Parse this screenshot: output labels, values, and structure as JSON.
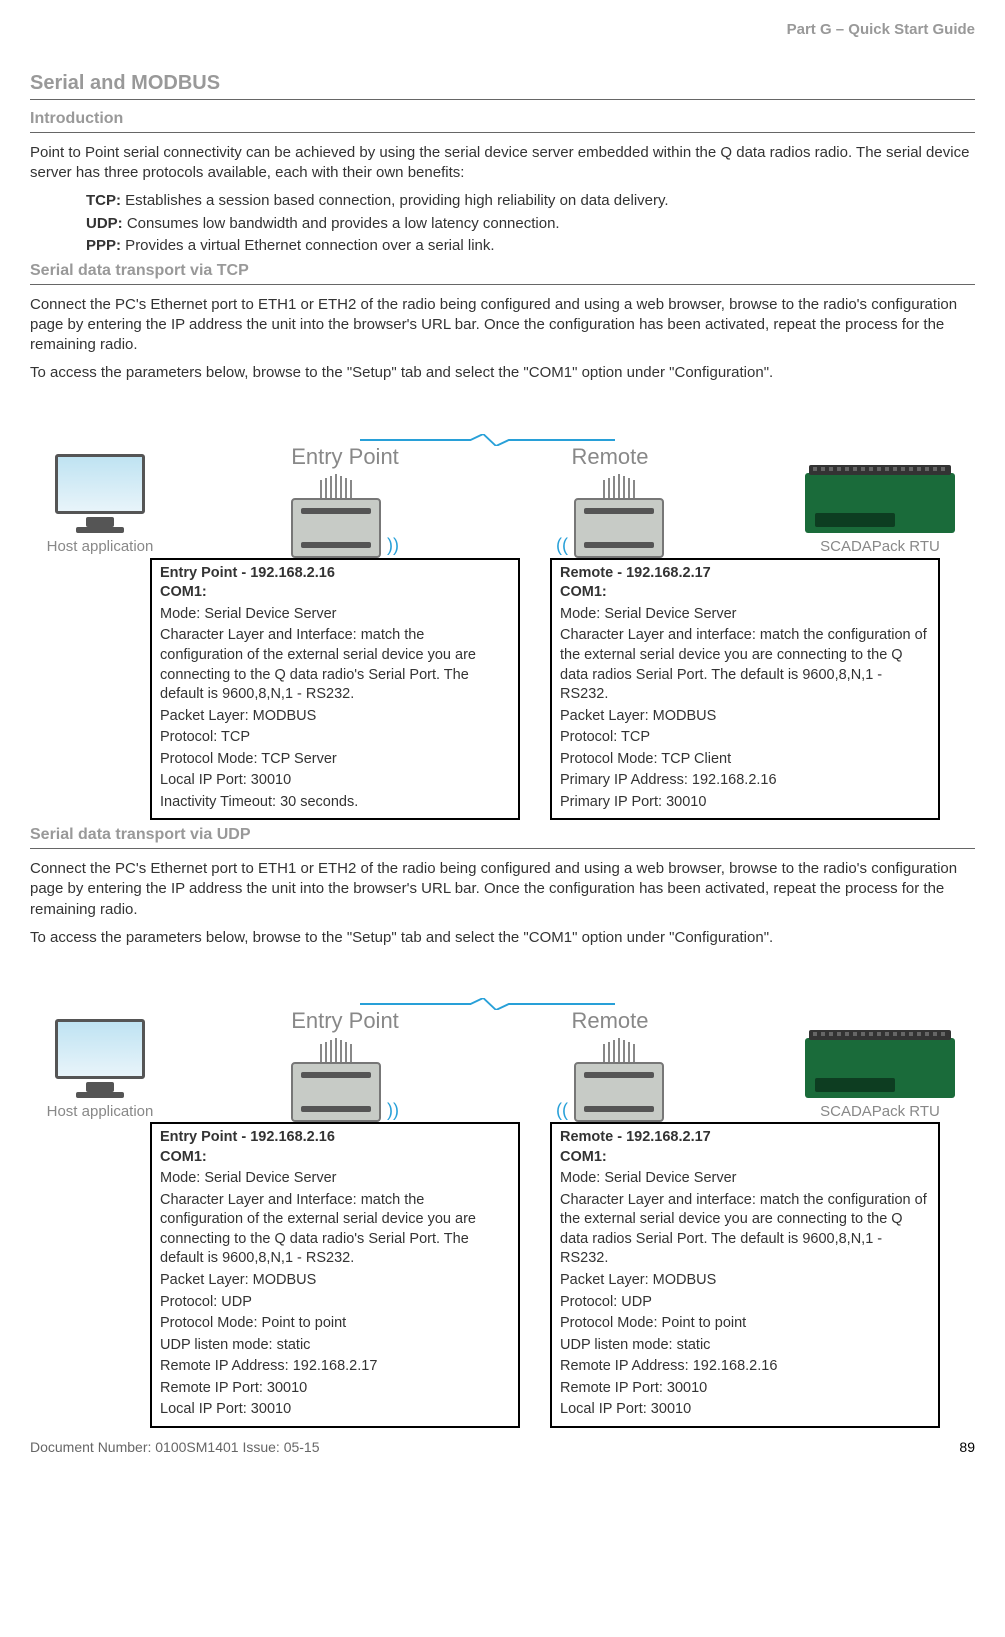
{
  "header": {
    "part": "Part G – Quick Start Guide"
  },
  "h1": "Serial and MODBUS",
  "intro_h": "Introduction",
  "intro_p": "Point to Point serial connectivity can be achieved by using the serial device server embedded within the Q data radios radio. The serial device server has three protocols available, each with their own benefits:",
  "protocols": {
    "tcp_label": "TCP:",
    "tcp_text": " Establishes a session based connection, providing high reliability on data delivery.",
    "udp_label": "UDP:",
    "udp_text": " Consumes low bandwidth and provides a low latency connection.",
    "ppp_label": "PPP:",
    "ppp_text": " Provides a virtual Ethernet connection over a serial link."
  },
  "tcp_h": "Serial data transport via TCP",
  "tcp_p1": "Connect the PC's Ethernet port to ETH1 or ETH2 of the radio being configured and using a web browser, browse to the radio's configuration page by entering the IP address the unit into the browser's URL bar.  Once the configuration has been activated, repeat the process for the remaining radio.",
  "tcp_p2": "To access the parameters below, browse to the \"Setup\" tab and select the \"COM1\" option under \"Configuration\".",
  "diagram_labels": {
    "host": "Host application",
    "entry": "Entry Point",
    "remote": "Remote",
    "scada": "SCADAPack RTU"
  },
  "tcp_entry": {
    "title": "Entry Point - 192.168.2.16",
    "com": "COM1:",
    "l1": "Mode: Serial Device Server",
    "l2": "Character Layer and Interface: match the configuration of the external serial device you are connecting to the Q data radio's Serial Port. The default is 9600,8,N,1 - RS232.",
    "l3": "Packet Layer: MODBUS",
    "l4": "Protocol: TCP",
    "l5": "Protocol Mode: TCP Server",
    "l6": "Local IP Port: 30010",
    "l7": "Inactivity Timeout: 30 seconds."
  },
  "tcp_remote": {
    "title": "Remote - 192.168.2.17",
    "com": "COM1:",
    "l1": "Mode: Serial Device Server",
    "l2": "Character Layer and interface: match the configuration of the external serial device you are connecting to the Q data radios Serial Port. The default is 9600,8,N,1 - RS232.",
    "l3": "Packet Layer: MODBUS",
    "l4": "Protocol: TCP",
    "l5": "Protocol Mode: TCP Client",
    "l6": "Primary IP Address: 192.168.2.16",
    "l7": "Primary IP Port: 30010"
  },
  "udp_h": "Serial data transport via UDP",
  "udp_p1": "Connect the PC's Ethernet port to ETH1 or ETH2 of the radio being configured and using a web browser, browse to the radio's configuration page by entering the IP address the unit into the browser's URL bar.  Once the configuration has been activated, repeat the process for the remaining radio.",
  "udp_p2": "To access the parameters below, browse to the \"Setup\" tab and select the \"COM1\" option under \"Configuration\".",
  "udp_entry": {
    "title": "Entry Point - 192.168.2.16",
    "com": "COM1:",
    "l1": "Mode: Serial Device Server",
    "l2": "Character Layer and Interface: match the configuration of the external serial device you are connecting to the Q data radio's Serial Port. The default is 9600,8,N,1 - RS232.",
    "l3": "Packet Layer: MODBUS",
    "l4": "Protocol: UDP",
    "l5": "Protocol Mode: Point to point",
    "l6": "UDP listen mode: static",
    "l7": "Remote IP Address: 192.168.2.17",
    "l8": "Remote IP Port: 30010",
    "l9": "Local IP Port: 30010"
  },
  "udp_remote": {
    "title": "Remote - 192.168.2.17",
    "com": "COM1:",
    "l1": "Mode: Serial Device Server",
    "l2": "Character Layer and interface: match the configuration of the external serial device you are connecting to the Q data radios Serial Port. The default is 9600,8,N,1 - RS232.",
    "l3": "Packet Layer: MODBUS",
    "l4": "Protocol: UDP",
    "l5": "Protocol Mode: Point to point",
    "l6": "UDP listen mode: static",
    "l7": "Remote IP Address: 192.168.2.16",
    "l8": "Remote IP Port: 30010",
    "l9": "Local IP Port: 30010"
  },
  "footer": {
    "doc": "Document Number: 0100SM1401   Issue: 05-15",
    "page": "89"
  }
}
